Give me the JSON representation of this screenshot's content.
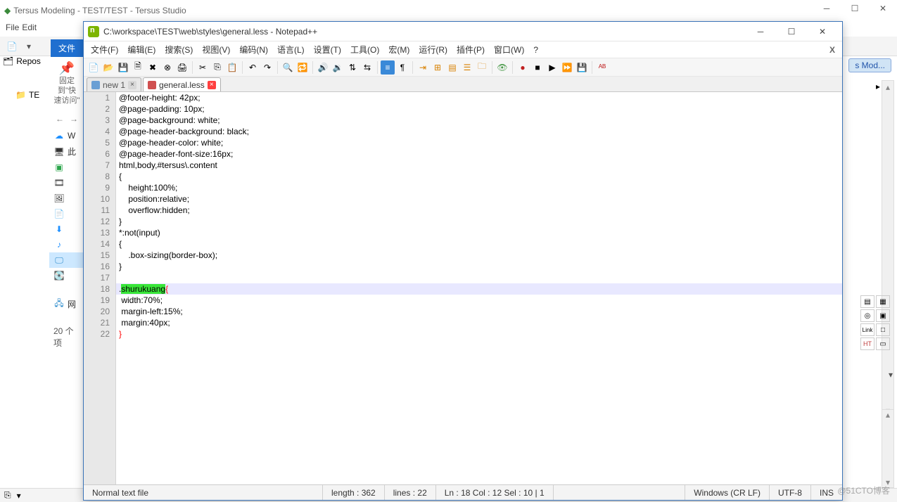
{
  "tersus": {
    "title": "Tersus Modeling - TEST/TEST - Tersus Studio",
    "menu": [
      "File",
      "Edit"
    ],
    "repository_label": "Repos",
    "tree_item": "TE",
    "tabs_right": "s Mod..."
  },
  "quick_access": {
    "pin_line1": "固定到\"快",
    "pin_line2": "速访问\"",
    "count": "20 个项",
    "items": [
      "W",
      "此",
      "",
      "",
      "",
      "",
      "",
      "",
      "",
      "",
      "",
      "网"
    ]
  },
  "notepadpp": {
    "title_path": "C:\\workspace\\TEST\\web\\styles\\general.less - Notepad++",
    "menu": [
      "文件(F)",
      "编辑(E)",
      "搜索(S)",
      "视图(V)",
      "编码(N)",
      "语言(L)",
      "设置(T)",
      "工具(O)",
      "宏(M)",
      "运行(R)",
      "插件(P)",
      "窗口(W)",
      "?"
    ],
    "tabs": [
      {
        "label": "new 1",
        "dirty": false
      },
      {
        "label": "general.less",
        "dirty": true
      }
    ],
    "code_lines": [
      "@footer-height: 42px;",
      "@page-padding: 10px;",
      "@page-background: white;",
      "@page-header-background: black;",
      "@page-header-color: white;",
      "@page-header-font-size:16px;",
      "html,body,#tersus\\.content",
      "{",
      "    height:100%;",
      "    position:relative;",
      "    overflow:hidden;",
      "}",
      "*:not(input)",
      "{",
      "    .box-sizing(border-box);",
      "}",
      "",
      ".shurukuang{",
      " width:70%;",
      " margin-left:15%;",
      " margin:40px;",
      "}"
    ],
    "highlight_line": 18,
    "highlight_token": "shurukuang",
    "status": {
      "type": "Normal text file",
      "length": "length : 362",
      "lines": "lines : 22",
      "pos": "Ln : 18   Col : 12   Sel : 10 | 1",
      "eol": "Windows (CR LF)",
      "enc": "UTF-8",
      "ins": "INS"
    }
  },
  "watermark": "@51CTO博客"
}
